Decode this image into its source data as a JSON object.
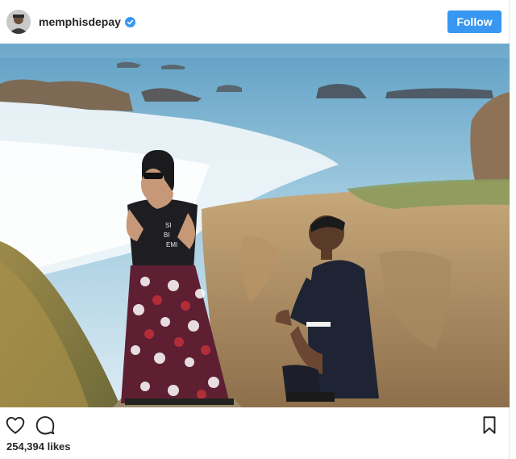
{
  "header": {
    "username": "memphisdepay",
    "follow_label": "Follow"
  },
  "photo": {
    "shirt_text": [
      "SI",
      "BI",
      "EMI"
    ]
  },
  "actions": {
    "like_icon": "heart-icon",
    "comment_icon": "comment-icon",
    "save_icon": "bookmark-icon"
  },
  "likes_text": "254,394 likes",
  "colors": {
    "follow_button": "#3897f0",
    "verified_badge": "#3897f0",
    "text": "#262626"
  }
}
